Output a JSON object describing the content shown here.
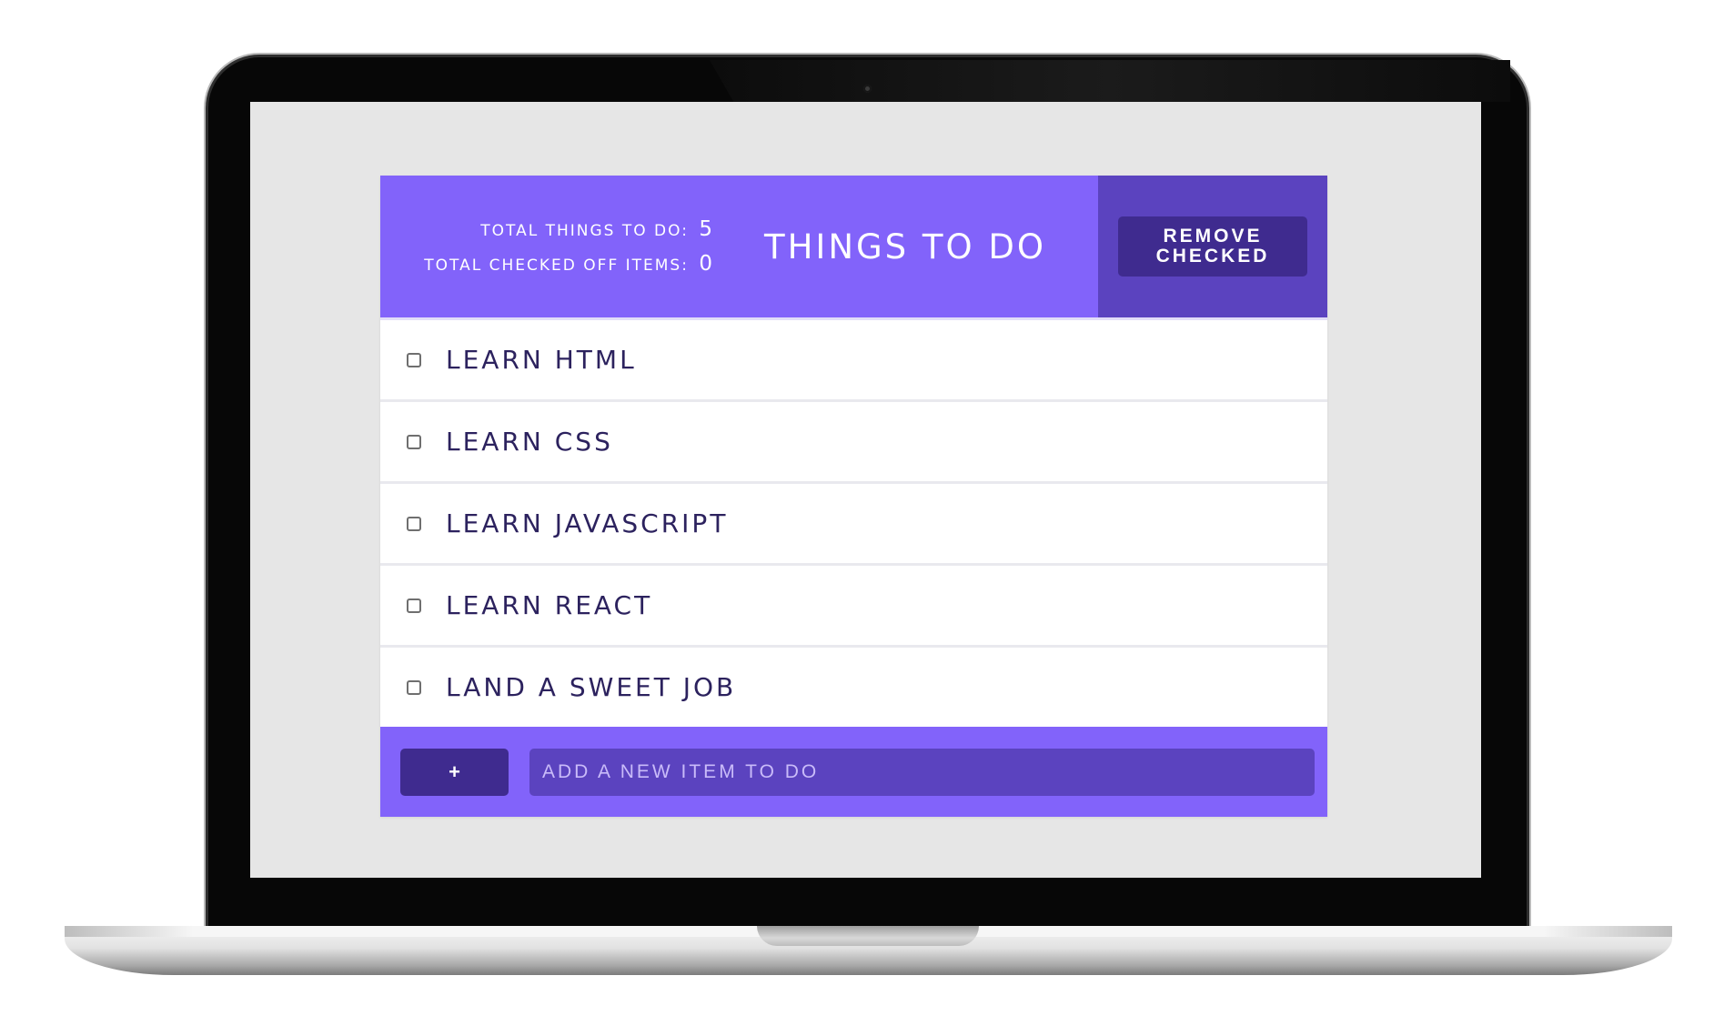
{
  "header": {
    "total_label": "TOTAL THINGS TO DO:",
    "total_value": "5",
    "checked_label": "TOTAL CHECKED OFF ITEMS:",
    "checked_value": "0",
    "title": "THINGS TO DO",
    "remove_button_label": "REMOVE\nCHECKED"
  },
  "items": [
    {
      "label": "LEARN HTML",
      "checked": false
    },
    {
      "label": "LEARN CSS",
      "checked": false
    },
    {
      "label": "LEARN JAVASCRIPT",
      "checked": false
    },
    {
      "label": "LEARN REACT",
      "checked": false
    },
    {
      "label": "LAND A SWEET JOB",
      "checked": false
    }
  ],
  "footer": {
    "add_button_label": "+",
    "input_value": "",
    "input_placeholder": "ADD A NEW ITEM TO DO"
  },
  "colors": {
    "primary": "#8263fa",
    "secondary": "#5b43bf",
    "dark": "#3f2b8f",
    "text": "#2c225e",
    "screen_background": "#e6e6e6"
  },
  "icons": {
    "add": "plus-icon",
    "camera": "webcam-icon"
  }
}
